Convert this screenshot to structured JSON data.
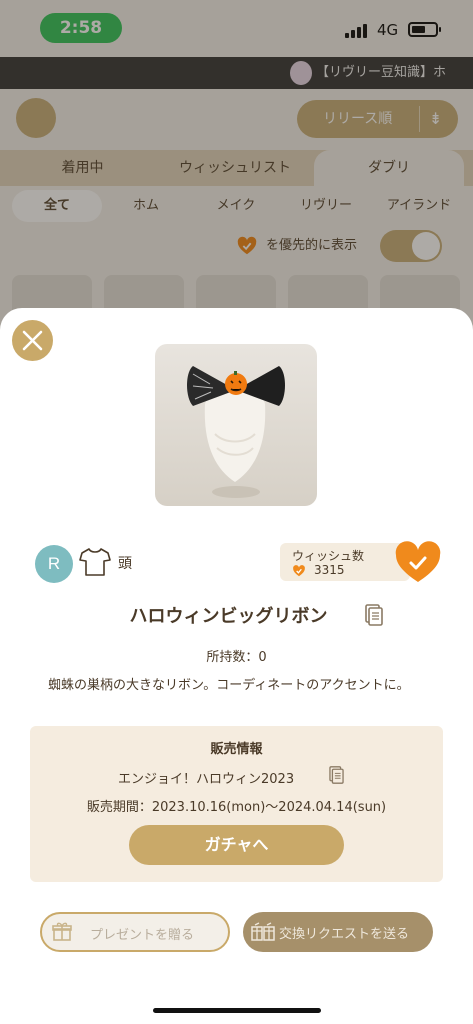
{
  "status_bar": {
    "time": "2:58",
    "network": "4G"
  },
  "ticker": {
    "text": "【リヴリー豆知識】ホ"
  },
  "background": {
    "sort_label": "リリース順",
    "main_tabs": [
      "着用中",
      "ウィッシュリスト",
      "ダブリ"
    ],
    "sub_tabs": [
      "全て",
      "ホム",
      "メイク",
      "リヴリー",
      "アイランド"
    ],
    "priority_label": "を優先的に表示"
  },
  "item": {
    "rarity": "R",
    "slot": "頭",
    "wish_label": "ウィッシュ数",
    "wish_count": "3315",
    "title": "ハロウィンビッグリボン",
    "owned": "所持数：0",
    "description": "蜘蛛の巣柄の大きなリボン。コーディネートのアクセントに。"
  },
  "sale": {
    "heading": "販売情報",
    "event": "エンジョイ！ハロウィン2023",
    "period": "販売期間：2023.10.16(mon)〜2024.04.14(sun)",
    "gacha_button": "ガチャへ"
  },
  "actions": {
    "present": "プレゼントを贈る",
    "trade": "交換リクエストを送る"
  },
  "colors": {
    "accent_gold": "#c9a969",
    "wish_orange": "#f08a1c",
    "rarity_teal": "#7ebcc0",
    "panel_beige": "#f5ecdf"
  },
  "icons": [
    "close-icon",
    "shirt-icon",
    "heart-check-icon",
    "copy-icon",
    "gift-icon",
    "trade-icon",
    "sort-icon"
  ]
}
